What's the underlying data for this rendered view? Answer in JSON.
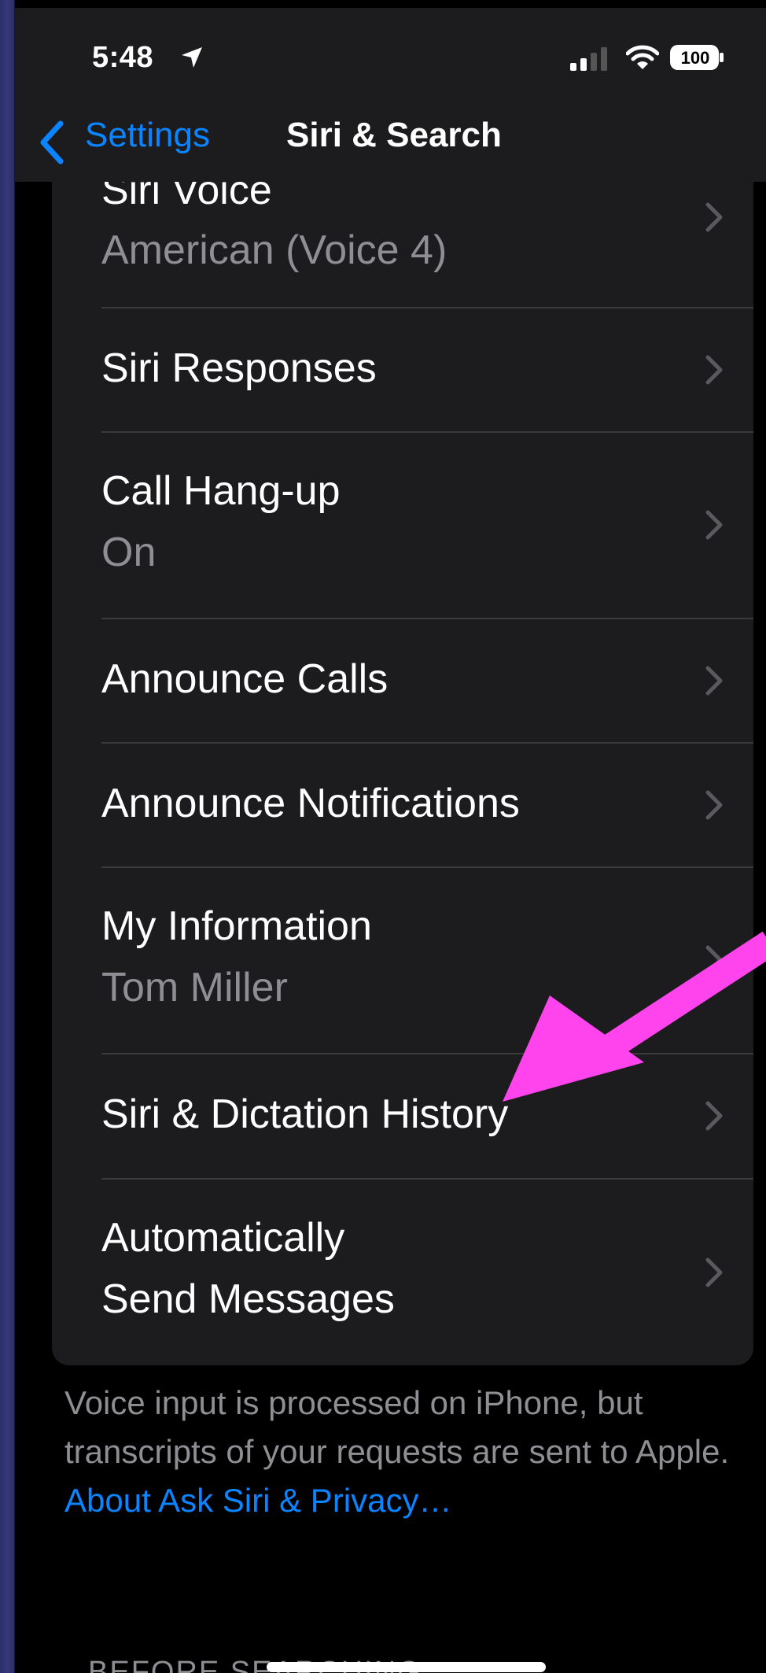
{
  "status_bar": {
    "time": "5:48",
    "battery": "100",
    "icons": [
      "location-arrow-icon",
      "cellular-signal-icon",
      "wifi-icon",
      "battery-icon"
    ]
  },
  "nav": {
    "back_label": "Settings",
    "title": "Siri & Search"
  },
  "rows": [
    {
      "title": "Siri Voice",
      "subtitle": "American (Voice 4)"
    },
    {
      "title": "Siri Responses"
    },
    {
      "title": "Call Hang-up",
      "subtitle": "On"
    },
    {
      "title": "Announce Calls"
    },
    {
      "title": "Announce Notifications"
    },
    {
      "title": "My Information",
      "subtitle": "Tom Miller"
    },
    {
      "title": "Siri & Dictation History"
    },
    {
      "title": "Automatically",
      "title_line2": "Send Messages"
    }
  ],
  "footer": {
    "text": "Voice input is processed on iPhone, but transcripts of your requests are sent to Apple. ",
    "link": "About Ask Siri & Privacy…"
  },
  "section_header": "BEFORE SEARCHING",
  "colors": {
    "background": "#000000",
    "surface": "#1c1c1e",
    "accent": "#0a84ff",
    "secondary_text": "#8e8e93",
    "annotation_arrow": "#ff44ee"
  }
}
